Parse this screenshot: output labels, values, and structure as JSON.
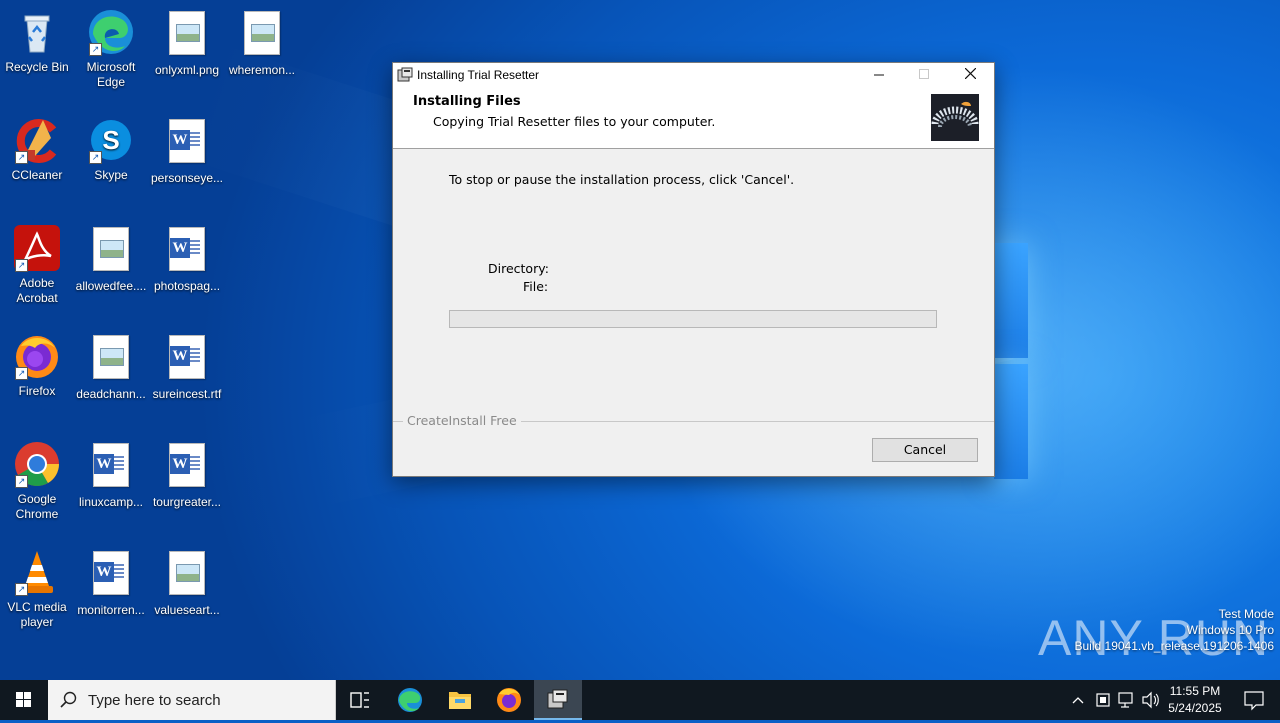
{
  "desktop": {
    "icons": [
      {
        "label": "Recycle Bin"
      },
      {
        "label": "Microsoft Edge"
      },
      {
        "label": "onlyxml.png"
      },
      {
        "label": "wheremon..."
      },
      {
        "label": "CCleaner"
      },
      {
        "label": "Skype"
      },
      {
        "label": "personseye..."
      },
      {
        "label": "Adobe Acrobat"
      },
      {
        "label": "allowedfee...."
      },
      {
        "label": "photospag..."
      },
      {
        "label": "Firefox"
      },
      {
        "label": "deadchann..."
      },
      {
        "label": "sureincest.rtf"
      },
      {
        "label": "Google Chrome"
      },
      {
        "label": "linuxcamp..."
      },
      {
        "label": "tourgreater..."
      },
      {
        "label": "VLC media player"
      },
      {
        "label": "monitorren..."
      },
      {
        "label": "valueseart..."
      }
    ]
  },
  "installer": {
    "title": "Installing Trial Resetter",
    "header_title": "Installing Files",
    "header_subtitle": "Copying Trial Resetter files to your computer.",
    "instruction": "To stop or pause the installation process, click 'Cancel'.",
    "directory_label": "Directory:",
    "file_label": "File:",
    "progress_fraction": 0,
    "brand": "CreateInstall Free",
    "cancel_label": "Cancel"
  },
  "watermark": {
    "brand": "ANY RUN",
    "line1": "Test Mode",
    "line2": "Windows 10 Pro",
    "line3": "Build 19041.vb_release.191206-1406"
  },
  "taskbar": {
    "search_placeholder": "Type here to search",
    "time": "11:55 PM",
    "date": "5/24/2025"
  },
  "colors": {
    "desktop_blue": "#0c6ad8",
    "taskbar": "#101820",
    "progress_green": "#06b025"
  }
}
